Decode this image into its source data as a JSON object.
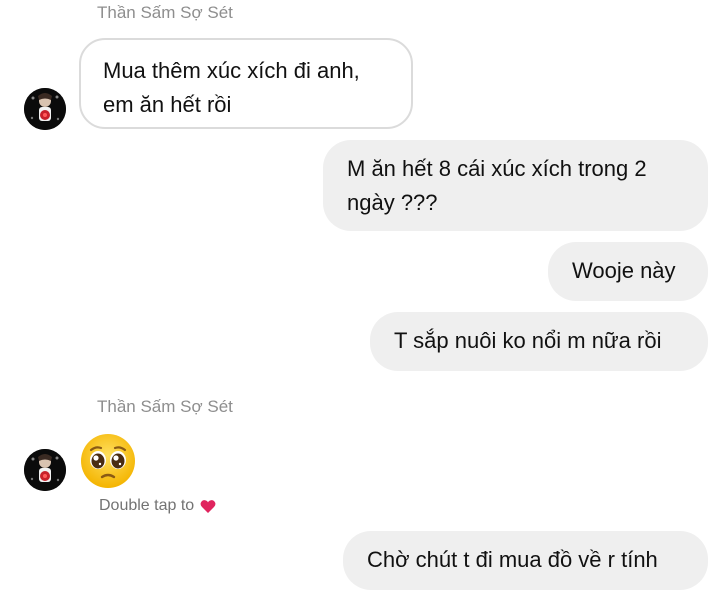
{
  "conversation": {
    "sender_name_1": "Thần Sấm Sợ Sét",
    "sender_name_2": "Thần Sấm Sợ Sét",
    "messages": [
      {
        "text": "Mua thêm xúc xích đi anh,\nem ăn hết rồi"
      },
      {
        "text": "M ăn hết 8 cái xúc xích trong 2\nngày ???"
      },
      {
        "text": "Wooje này"
      },
      {
        "text": "T sắp nuôi ko nổi m nữa rồi"
      },
      {
        "text": "Chờ chút t đi mua đồ về r tính"
      }
    ],
    "emoji_message": "pleading-face-emoji",
    "reaction_hint": "Double tap to",
    "reaction_icon": "red-heart-icon",
    "colors": {
      "incoming_border": "#dbdbdb",
      "outgoing_bg": "#efefef",
      "meta_text": "#8e8e8e",
      "heart": "#e0245e"
    }
  }
}
